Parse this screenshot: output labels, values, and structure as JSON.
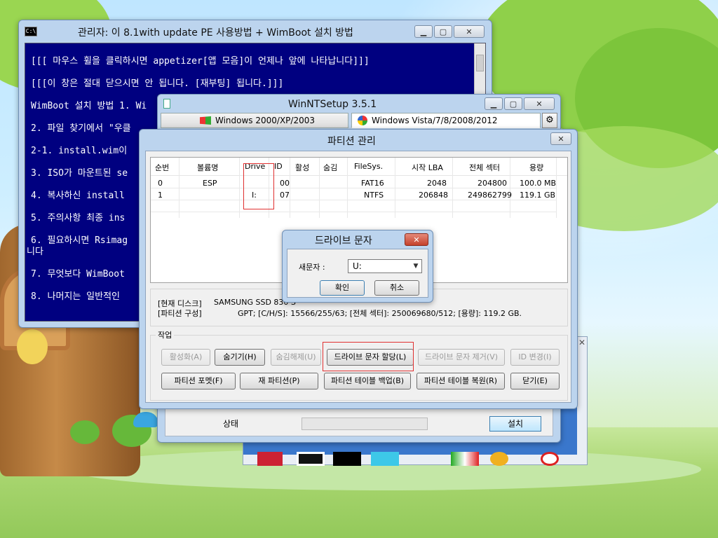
{
  "console": {
    "icon": "C:\\",
    "title": "관리자:  이 8.1with update PE 사용방법 + WimBoot 설치 방법",
    "lines": [
      "[[[ 마우스 휠을 클릭하시면 appetizer[앱 모음]이 언제나 앞에 나타납니다]]]",
      "[[[이 창은 절대 닫으시면 안 됩니다. [재부팅] 됩니다.]]]",
      "WimBoot 설치 방법 1. Wi",
      "2. 파일 찾기에서 \"우클",
      "2-1. install.wim이",
      "3. ISO가 마운트된 se",
      "4. 복사하신 install",
      "5. 주의사항 최종 ins",
      "6. 필요하시면 Rsimag",
      "니다",
      "7. 무엇보다 WimBoot",
      "8. 나머지는 일반적인"
    ]
  },
  "winnt": {
    "title": "WinNTSetup 3.5.1",
    "tabs": [
      "Windows 2000/XP/2003",
      "Windows Vista/7/8/2008/2012"
    ],
    "status_label": "상태",
    "install_button": "설치"
  },
  "partition_dialog": {
    "title": "파티션 관리",
    "columns": [
      "순번",
      "볼륨명",
      "Drive",
      "ID",
      "활성",
      "숨김",
      "FileSys.",
      "시작 LBA",
      "전체 섹터",
      "용량"
    ],
    "rows": [
      [
        "0",
        "ESP",
        "",
        "00",
        "",
        "",
        "FAT16",
        "2048",
        "204800",
        "100.0 MB"
      ],
      [
        "1",
        "",
        "I:",
        "07",
        "",
        "",
        "NTFS",
        "206848",
        "249862799",
        "119.1 GB"
      ]
    ],
    "info": {
      "disk_label": "[현재 디스크]",
      "disk_value": "SAMSUNG SSD 830 S",
      "part_label": "[파티션 구성]",
      "part_value": "GPT;      [C/H/S]: 15566/255/63; [전체 섹터]: 250069680/512; [용량]: 119.2 GB."
    },
    "group_label": "작업",
    "buttons_row1": [
      "활성화(A)",
      "숨기기(H)",
      "숨김해제(U)",
      "드라이브 문자 할당(L)",
      "드라이브 문자 제거(V)",
      "ID 변경(I)"
    ],
    "buttons_row2": [
      "파티션 포멧(F)",
      "재 파티션(P)",
      "파티션 테이블 백업(B)",
      "파티션 테이블 복원(R)",
      "닫기(E)"
    ]
  },
  "drive_dialog": {
    "title": "드라이브 문자",
    "new_letter_label": "새문자 :",
    "selected_letter": "U:",
    "ok": "확인",
    "cancel": "취소"
  },
  "colors": {
    "console_bg": "#000080",
    "highlight_red": "#e03030",
    "title_close_red": "#c4412c"
  }
}
